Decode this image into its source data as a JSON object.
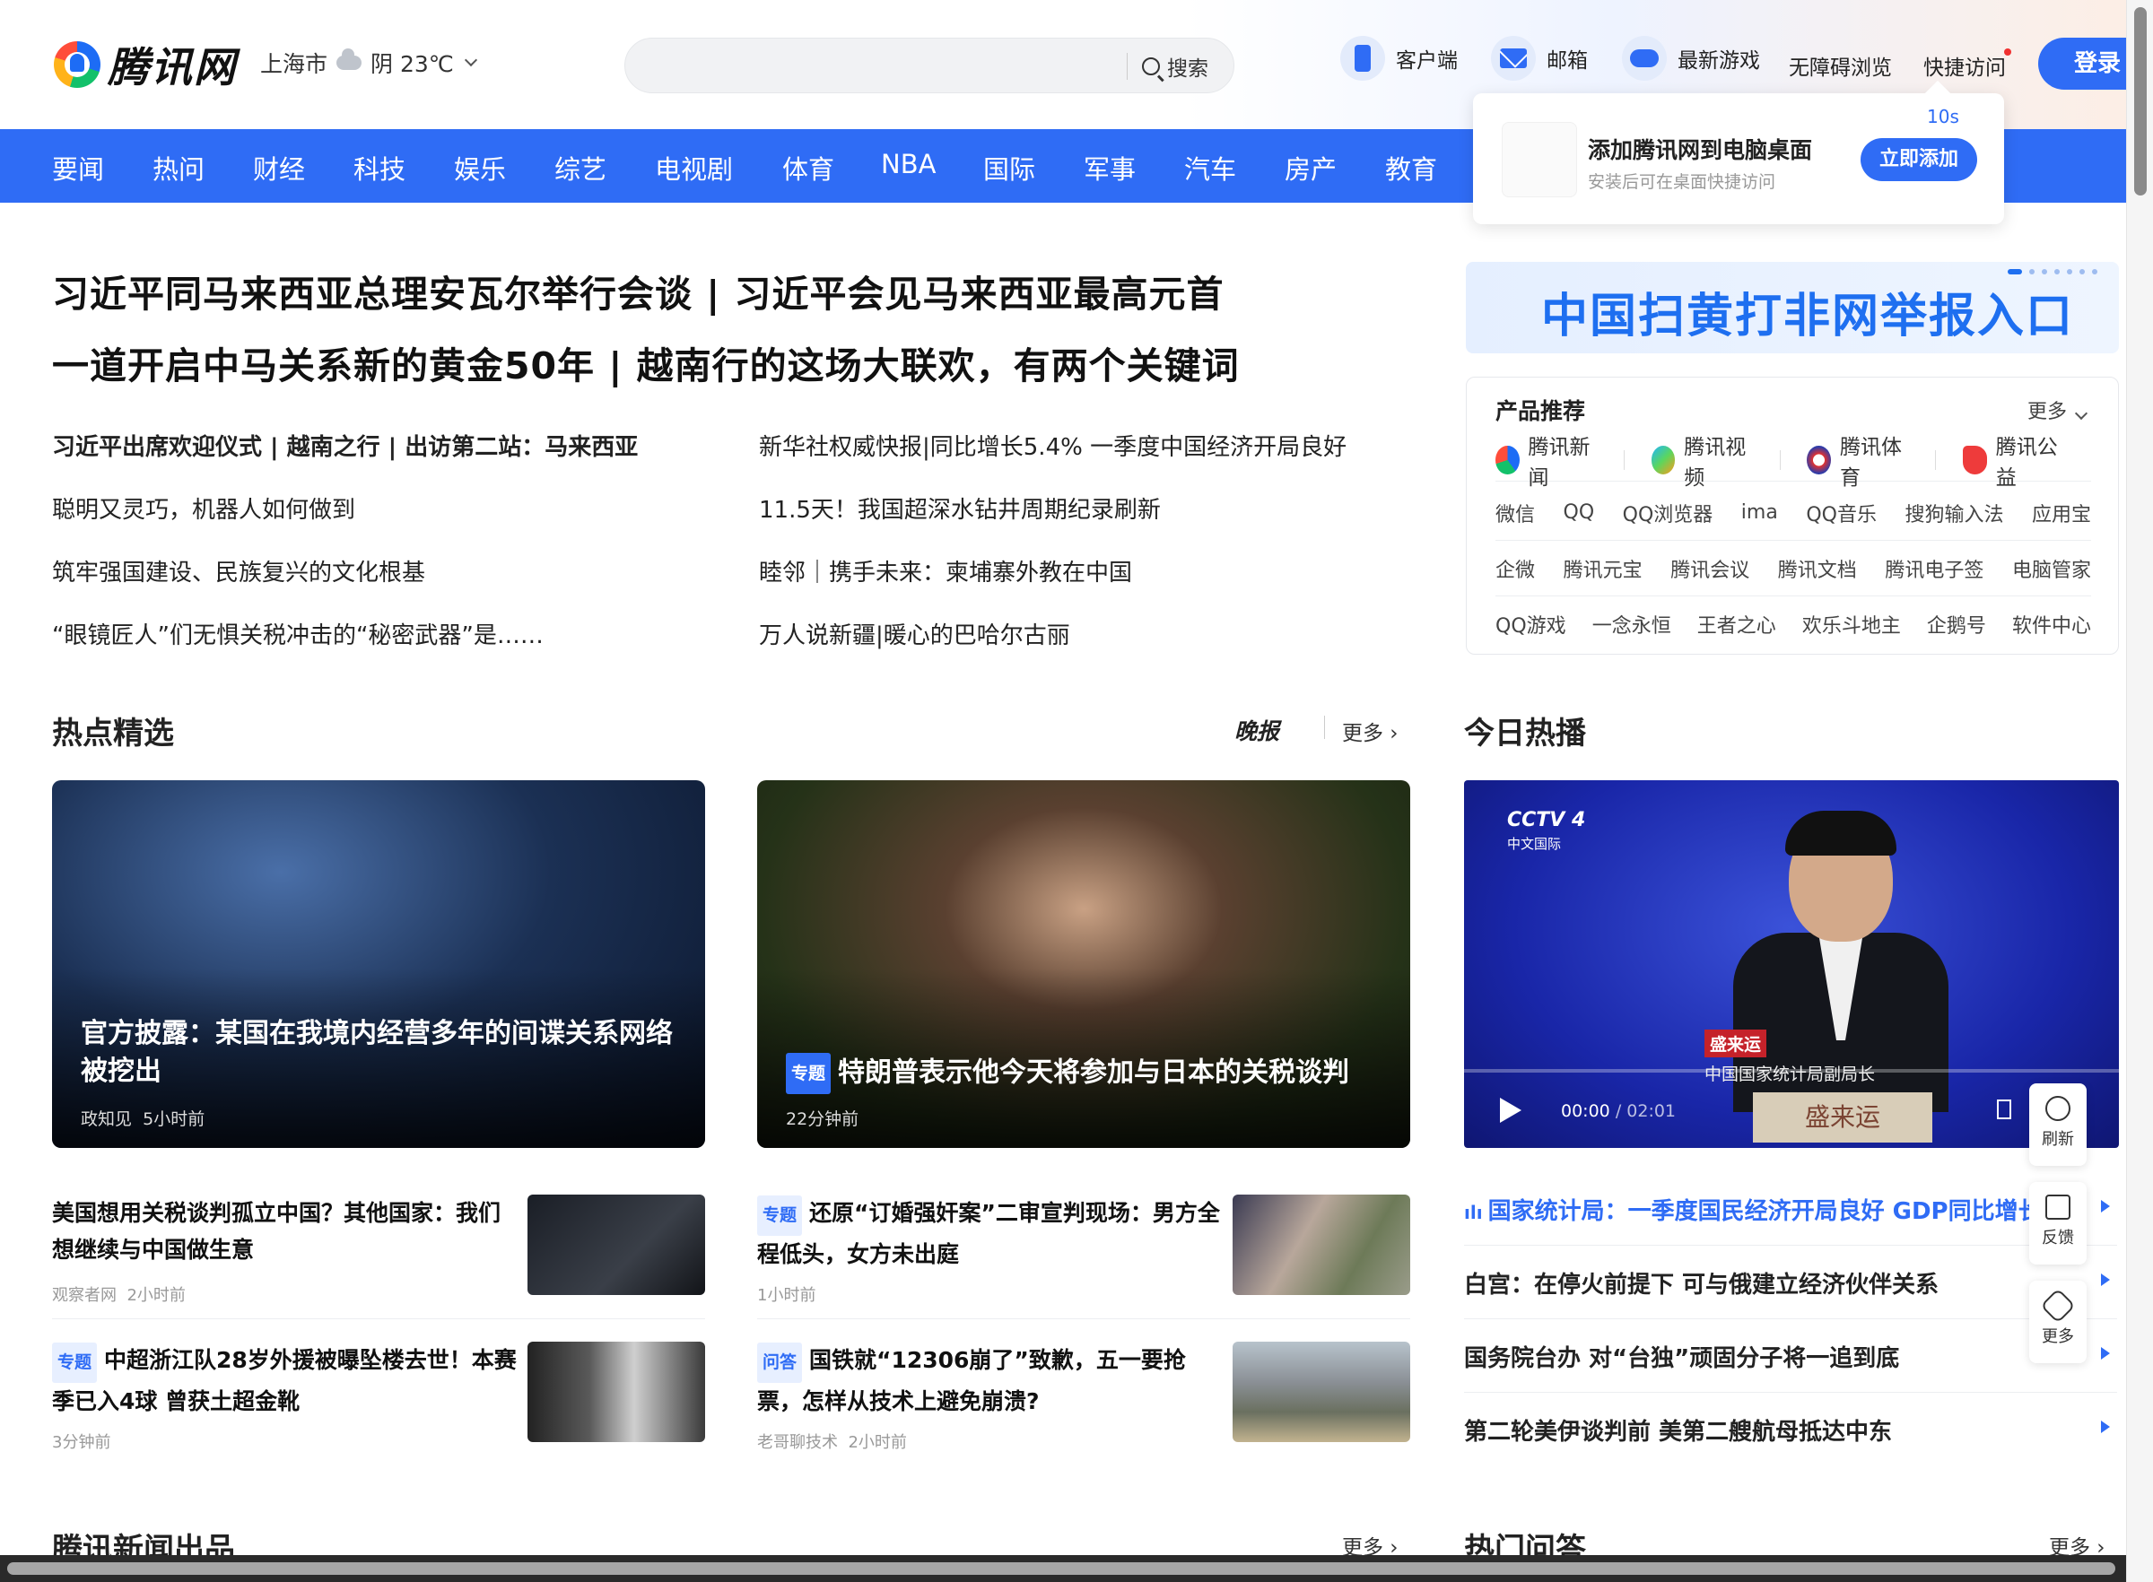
{
  "header": {
    "logo_text": "腾讯网",
    "city": "上海市",
    "weather": "阴 23℃",
    "search_placeholder": "",
    "search_label": "搜索",
    "tools": [
      "客户端",
      "邮箱",
      "最新游戏",
      "无障碍浏览",
      "快捷访问"
    ],
    "login": "登录"
  },
  "channels": [
    "要闻",
    "热问",
    "财经",
    "科技",
    "娱乐",
    "综艺",
    "电视剧",
    "体育",
    "NBA",
    "国际",
    "军事",
    "汽车",
    "房产",
    "教育"
  ],
  "popup": {
    "title": "添加腾讯网到电脑桌面",
    "subtitle": "安装后可在桌面快捷访问",
    "timer": "10s",
    "button": "立即添加"
  },
  "headlines": [
    "习近平同马来西亚总理安瓦尔举行会谈 | 习近平会见马来西亚最高元首",
    "一道开启中马关系新的黄金50年 | 越南行的这场大联欢，有两个关键词"
  ],
  "news_left": [
    "习近平出席欢迎仪式 | 越南之行 | 出访第二站：马来西亚",
    "聪明又灵巧，机器人如何做到",
    "筑牢强国建设、民族复兴的文化根基",
    "“眼镜匠人”们无惧关税冲击的“秘密武器”是……"
  ],
  "news_right": [
    "新华社权威快报|同比增长5.4% 一季度中国经济开局良好",
    "11.5天！我国超深水钻井周期纪录刷新",
    "睦邻｜携手未来：柬埔寨外教在中国",
    "万人说新疆|暖心的巴哈尔古丽"
  ],
  "banner": {
    "text": "中国扫黄打非网举报入口"
  },
  "products": {
    "title": "产品推荐",
    "more": "更多",
    "apps": [
      "腾讯新闻",
      "腾讯视频",
      "腾讯体育",
      "腾讯公益"
    ],
    "row1": [
      "微信",
      "QQ",
      "QQ浏览器",
      "ima",
      "QQ音乐",
      "搜狗输入法",
      "应用宝"
    ],
    "row2": [
      "企微",
      "腾讯元宝",
      "腾讯会议",
      "腾讯文档",
      "腾讯电子签",
      "电脑管家"
    ],
    "row3": [
      "QQ游戏",
      "一念永恒",
      "王者之心",
      "欢乐斗地主",
      "企鹅号",
      "软件中心"
    ]
  },
  "hot_section": {
    "title": "热点精选",
    "zaobao": "晚报",
    "more": "更多"
  },
  "today_section": {
    "title": "今日热播"
  },
  "cards": [
    {
      "title": "官方披露：某国在我境内经营多年的间谍关系网络被挖出",
      "source": "政知见",
      "time": "5小时前"
    },
    {
      "tag": "专题",
      "title": "特朗普表示他今天将参加与日本的关税谈判",
      "time": "22分钟前"
    }
  ],
  "video": {
    "channel": "CCTV 4",
    "channel_sub": "中文国际",
    "speaker_name": "盛来运",
    "speaker_role": "中国国家统计局副局长",
    "nameplate": "盛来运",
    "time_current": "00:00",
    "time_total": "02:01",
    "progress": 0.0
  },
  "small_news": [
    {
      "title": "美国想用关税谈判孤立中国？其他国家：我们想继续与中国做生意",
      "source": "观察者网",
      "time": "2小时前"
    },
    {
      "tag": "专题",
      "title": "还原“订婚强奸案”二审宣判现场：男方全程低头，女方未出庭",
      "source": "",
      "time": "1小时前"
    },
    {
      "tag": "专题",
      "title": "中超浙江队28岁外援被曝坠楼去世！本赛季已入4球 曾获土超金靴",
      "source": "",
      "time": "3分钟前"
    },
    {
      "tag": "问答",
      "title": "国铁就“12306崩了”致歉，五一要抢票，怎样从技术上避免崩溃?",
      "source": "老哥聊技术",
      "time": "2小时前"
    }
  ],
  "hot_list": [
    "国家统计局：一季度国民经济开局良好 GDP同比增长",
    "白宫：在停火前提下 可与俄建立经济伙伴关系",
    "国务院台办 对“台独”顽固分子将一追到底",
    "第二轮美伊谈判前 美第二艘航母抵达中东"
  ],
  "side_tools": [
    "刷新",
    "反馈",
    "更多"
  ],
  "bottom_sections": {
    "left": "腾讯新闻出品",
    "right": "热门问答",
    "more": "更多"
  },
  "colors": {
    "brand": "#2f6cf5"
  }
}
